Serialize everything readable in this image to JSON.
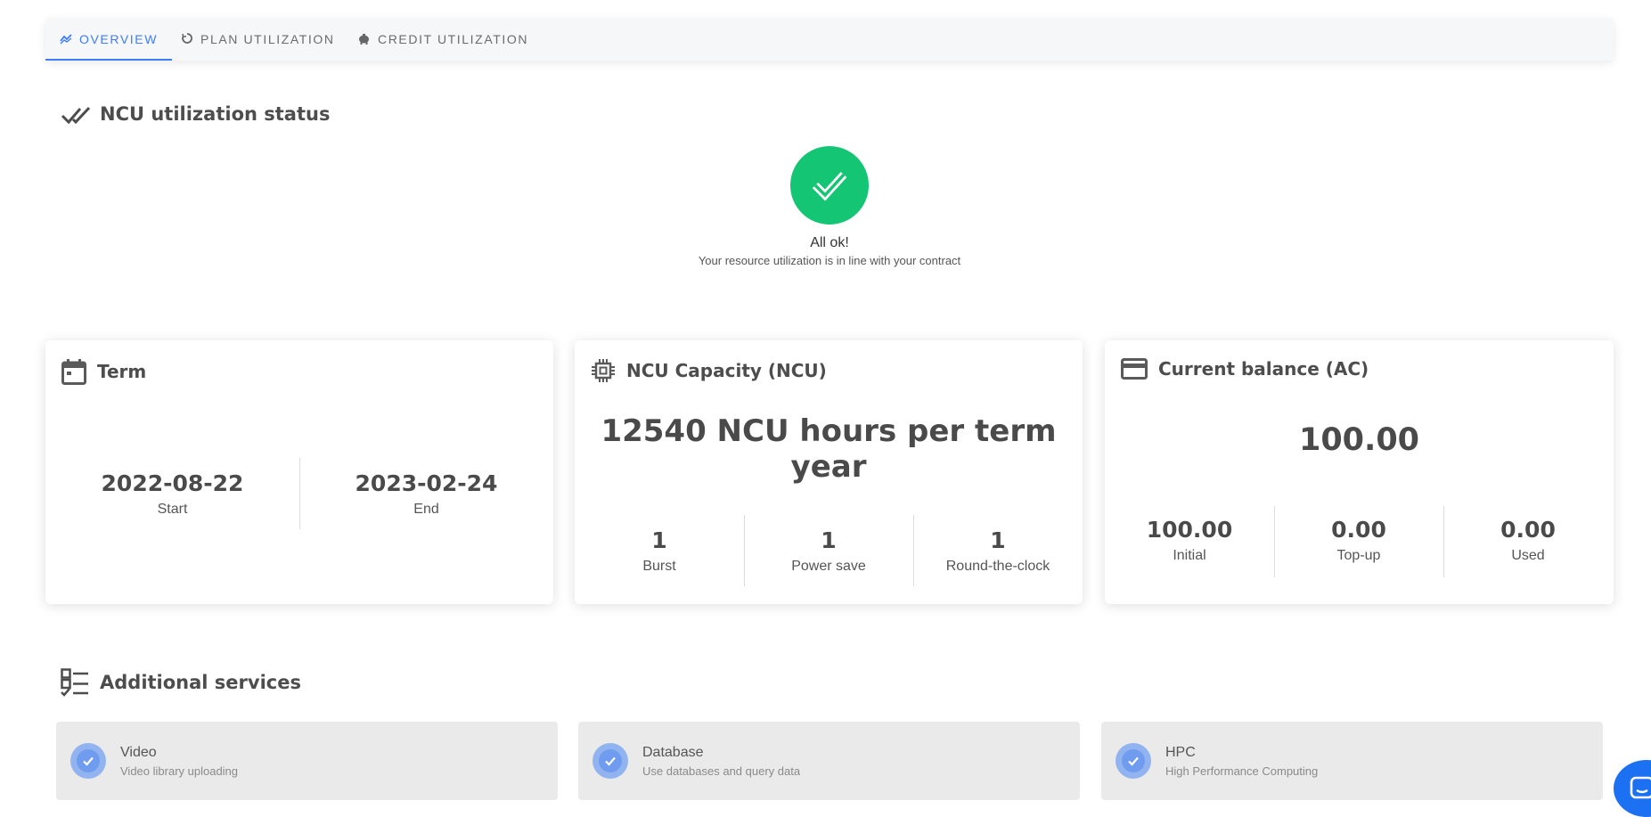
{
  "tabs": [
    {
      "label": "OVERVIEW",
      "icon": "overview-chart-icon",
      "active": true
    },
    {
      "label": "PLAN UTILIZATION",
      "icon": "refresh-circle-icon",
      "active": false
    },
    {
      "label": "CREDIT UTILIZATION",
      "icon": "piggy-bank-icon",
      "active": false
    }
  ],
  "status_section": {
    "title": "NCU utilization status",
    "status_title": "All ok!",
    "status_text": "Your resource utilization is in line with your contract"
  },
  "term": {
    "title": "Term",
    "start_value": "2022-08-22",
    "start_label": "Start",
    "end_value": "2023-02-24",
    "end_label": "End"
  },
  "capacity": {
    "title": "NCU Capacity (NCU)",
    "headline_line1": "12540 NCU hours per term",
    "headline_line2": "year",
    "stats": [
      {
        "value": "1",
        "label": "Burst"
      },
      {
        "value": "1",
        "label": "Power save"
      },
      {
        "value": "1",
        "label": "Round-the-clock"
      }
    ]
  },
  "balance": {
    "title": "Current balance (AC)",
    "headline": "100.00",
    "stats": [
      {
        "value": "100.00",
        "label": "Initial"
      },
      {
        "value": "0.00",
        "label": "Top-up"
      },
      {
        "value": "0.00",
        "label": "Used"
      }
    ]
  },
  "additional": {
    "title": "Additional services",
    "services": [
      {
        "name": "Video",
        "description": "Video library uploading"
      },
      {
        "name": "Database",
        "description": "Use databases and query data"
      },
      {
        "name": "HPC",
        "description": "High Performance Computing"
      }
    ]
  },
  "colors": {
    "accent": "#3d7cff",
    "status_ok": "#14c673",
    "service_check": "#6f9cee",
    "chat": "#1b71f2"
  }
}
